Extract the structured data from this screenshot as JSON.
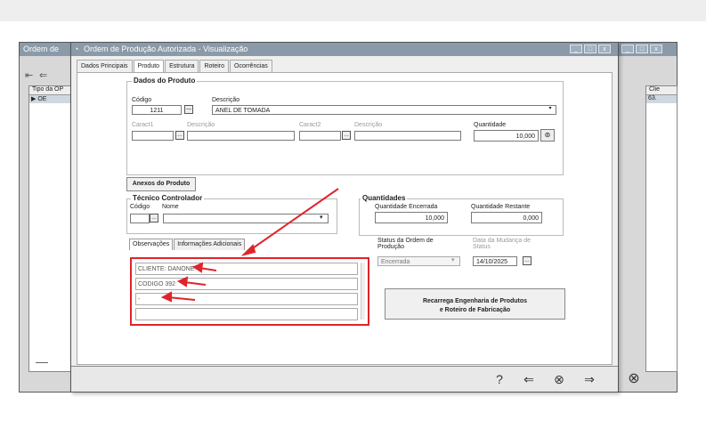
{
  "background_window": {
    "title": "Ordem de",
    "grid": {
      "col1_header": "Tipo da OP",
      "col1_value": "OE",
      "col2_header": "Clie",
      "col2_value": "63."
    }
  },
  "window": {
    "title": "Ordem de Produção Autorizada - Visualização",
    "tabs": [
      "Dados Principais",
      "Produto",
      "Estrutura",
      "Roteiro",
      "Ocorrências"
    ],
    "active_tab": "Produto"
  },
  "produto": {
    "group_title": "Dados do Produto",
    "codigo_label": "Código",
    "codigo_value": "1211",
    "descricao_label": "Descrição",
    "descricao_value": "ANEL DE TOMADA",
    "caract1_label": "Caract1",
    "caract1_desc_label": "Descrição",
    "caract2_label": "Caract2",
    "caract2_desc_label": "Descrição",
    "quantidade_label": "Quantidade",
    "quantidade_value": "10,000"
  },
  "anexos_button": "Anexos do Produto",
  "tecnico": {
    "title": "Técnico Controlador",
    "codigo_label": "Código",
    "nome_label": "Nome"
  },
  "quantidades": {
    "title": "Quantidades",
    "encerrada_label": "Quantidade Encerrada",
    "encerrada_value": "10,000",
    "restante_label": "Quantidade Restante",
    "restante_value": "0,000"
  },
  "subtabs": [
    "Observações",
    "Informações Adicionais"
  ],
  "status": {
    "label_line1": "Status da Ordem de",
    "label_line2": "Produção",
    "value": "Encerrada",
    "data_label_line1": "Data da Mudança de",
    "data_label_line2": "Status",
    "data_value": "14/10/2025"
  },
  "observacoes": [
    "CLIENTE: DANONE",
    "CODIGO 392",
    "-",
    ""
  ],
  "recarrega_button": {
    "line1": "Recarrega Engenharia de Produtos",
    "line2": "e Roteiro de Fabricação"
  },
  "icons": [
    "help-icon",
    "back-arrow-icon",
    "close-circle-icon",
    "forward-arrow-icon"
  ],
  "colors": {
    "annotation": "#e0242c",
    "titlebar": "#8a9aa8"
  }
}
